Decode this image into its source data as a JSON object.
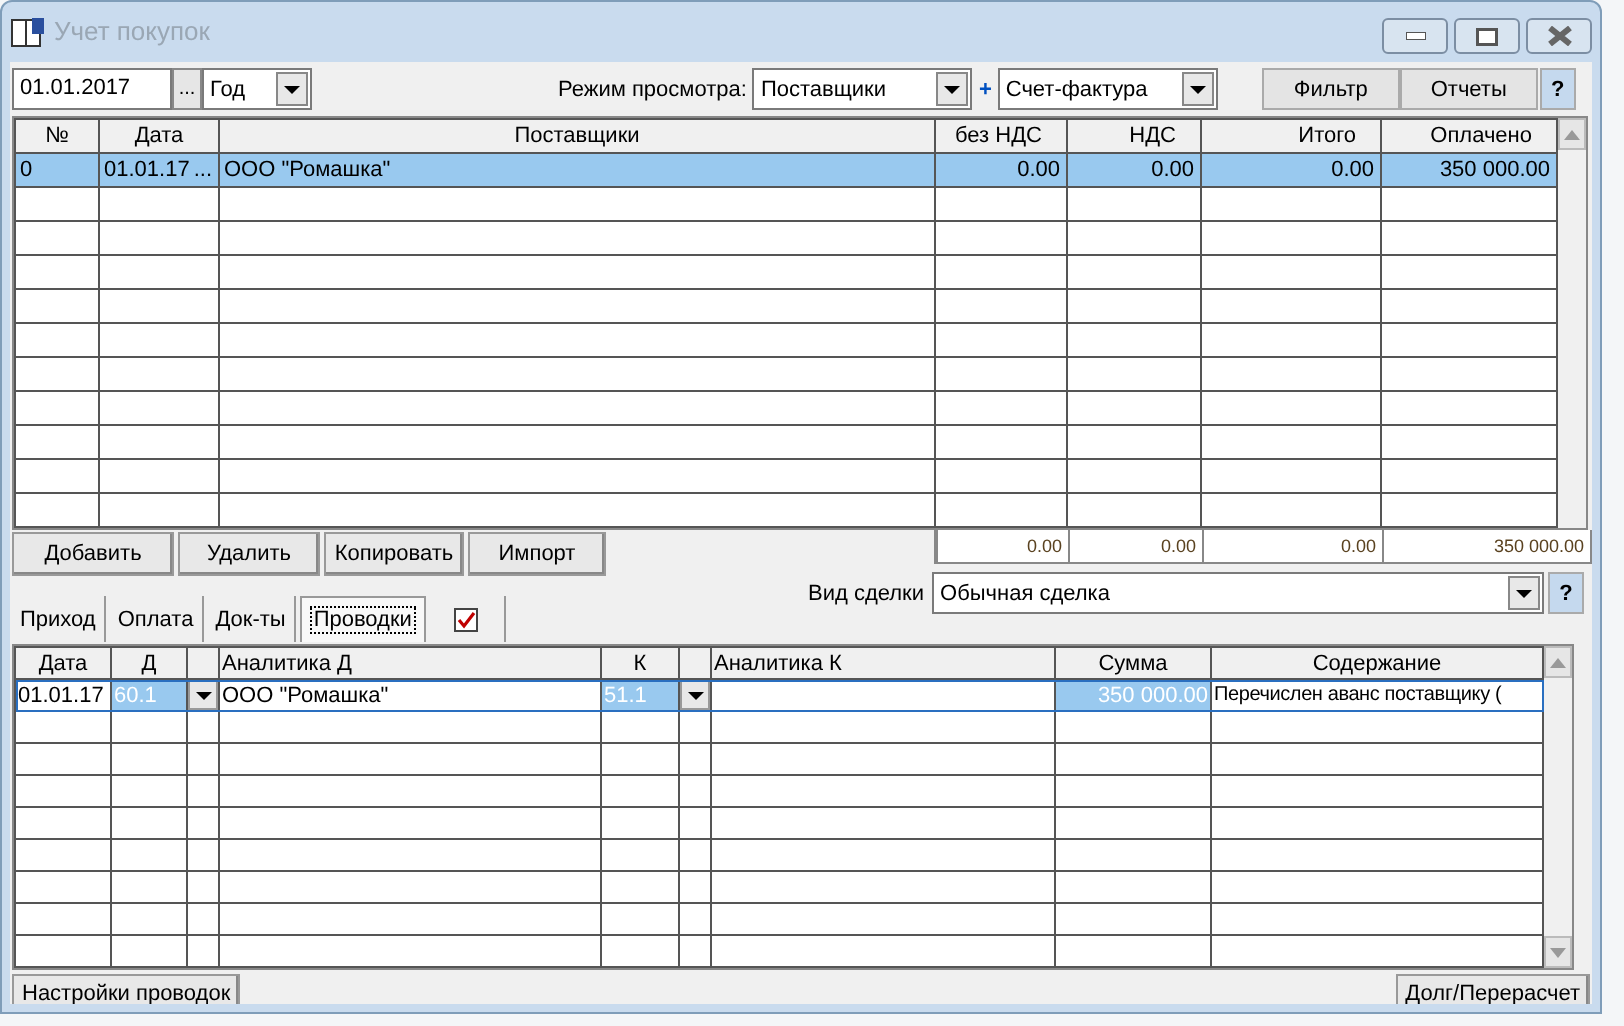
{
  "window": {
    "title": "Учет покупок"
  },
  "toolbar": {
    "date": "01.01.2017",
    "date_button": "...",
    "period": "Год",
    "view_mode_label": "Режим просмотра:",
    "view_mode": "Поставщики",
    "plus": "+",
    "document_type": "Счет-фактура",
    "buttons": [
      "Фильтр",
      "Отчеты"
    ],
    "help": "?"
  },
  "purchases_table": {
    "columns": [
      "№",
      "Дата",
      "Поставщики",
      "без НДС",
      "НДС",
      "Итого",
      "Оплачено"
    ],
    "rows": [
      {
        "number": "0",
        "date": "01.01.17",
        "date_button": "...",
        "supplier": "ООО \"Ромашка\"",
        "net": "0.00",
        "vat": "0.00",
        "total": "0.00",
        "paid": "350 000.00",
        "selected": true
      }
    ],
    "totals": [
      "0.00",
      "0.00",
      "0.00",
      "350 000.00"
    ]
  },
  "actions": [
    "Добавить",
    "Удалить",
    "Копировать",
    "Импорт"
  ],
  "deal_type": {
    "label": "Вид сделки",
    "value": "Обычная сделка",
    "help": "?"
  },
  "tabs": [
    {
      "kind": "text",
      "label": "Приход",
      "selected": false
    },
    {
      "kind": "text",
      "label": "Оплата",
      "selected": false
    },
    {
      "kind": "text",
      "label": "Док-ты",
      "selected": false
    },
    {
      "kind": "text",
      "label": "Проводки",
      "selected": true
    },
    {
      "kind": "checkbox",
      "checked": true,
      "selected": false
    }
  ],
  "entries_table": {
    "columns": [
      "Дата",
      "Д",
      "Аналитика Д",
      "К",
      "Аналитика К",
      "Сумма",
      "Содержание"
    ],
    "rows": [
      {
        "date": "01.01.17",
        "debit": "60.1",
        "debit_analytics": "ООО \"Ромашка\"",
        "credit": "51.1",
        "amount": "350 000.00",
        "description": "Перечислен аванс поставщику (",
        "selected": true
      }
    ]
  },
  "bottom_buttons": [
    "Настройки проводок",
    "Долг/Перерасчет"
  ]
}
